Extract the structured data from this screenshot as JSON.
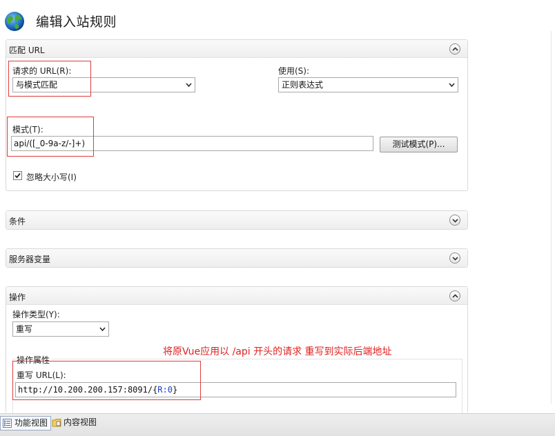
{
  "header": {
    "title": "编辑入站规则"
  },
  "match_url": {
    "title": "匹配 URL",
    "requested_url_label": "请求的 URL(R):",
    "requested_url_value": "与模式匹配",
    "using_label": "使用(S):",
    "using_value": "正则表达式",
    "pattern_label": "模式(T):",
    "pattern_value": "api/([_0-9a-z/-]+)",
    "test_button": "测试模式(P)...",
    "ignore_case_label": "忽略大小写(I)",
    "ignore_case_checked": true
  },
  "conditions": {
    "title": "条件"
  },
  "server_variables": {
    "title": "服务器变量"
  },
  "action": {
    "title": "操作",
    "type_label": "操作类型(Y):",
    "type_value": "重写",
    "properties_label": "操作属性",
    "rewrite_url_label": "重写 URL(L):",
    "rewrite_url_prefix": "http://10.200.200.157:8091/{",
    "rewrite_url_token": "R:0",
    "rewrite_url_suffix": "}"
  },
  "annotation": {
    "text": "将原Vue应用以 /api 开头的请求 重写到实际后端地址"
  },
  "bottom_tabs": [
    {
      "label": "功能视图",
      "active": true
    },
    {
      "label": "内容视图",
      "active": false
    }
  ],
  "colors": {
    "annotation": "#e02020",
    "token": "#1a3ccc"
  }
}
